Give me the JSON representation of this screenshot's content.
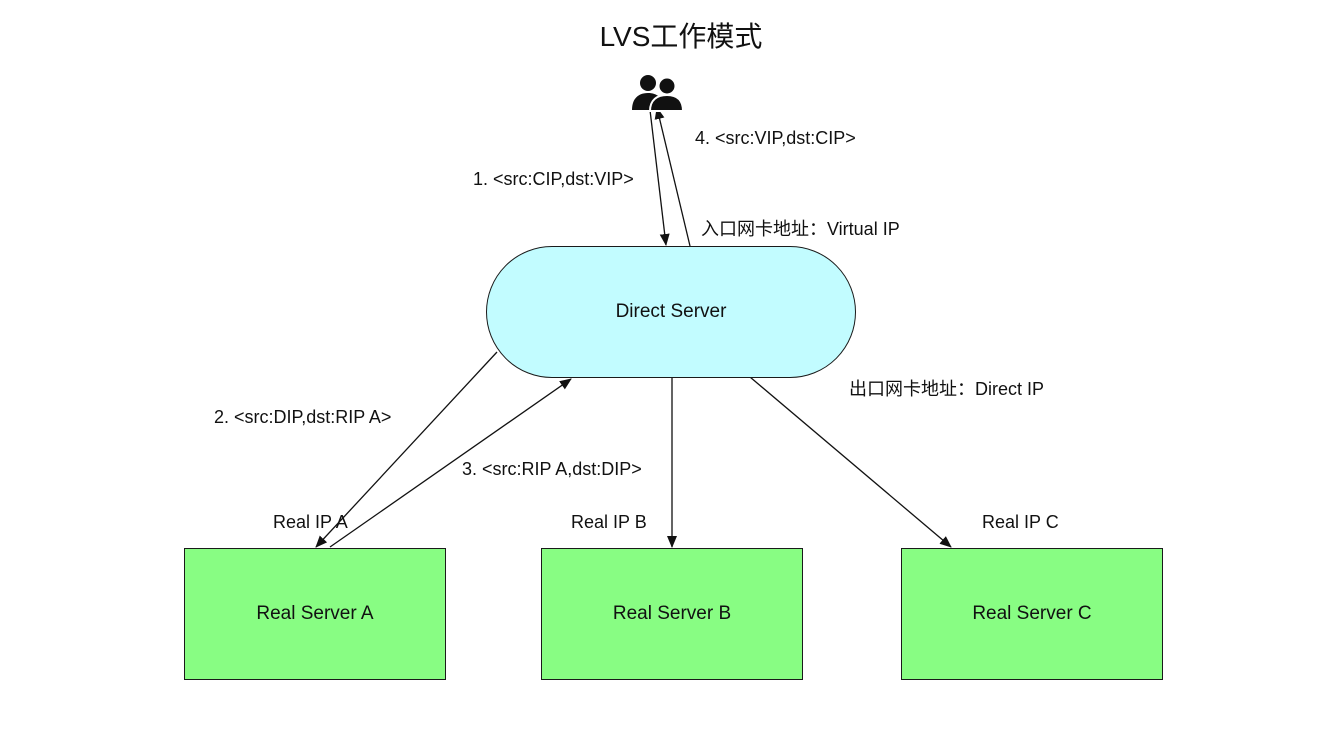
{
  "title": "LVS工作模式",
  "client": {
    "icon": "users-icon"
  },
  "direct_server": {
    "label": "Direct Server"
  },
  "interface_labels": {
    "ingress": "入口网卡地址：Virtual IP",
    "egress": "出口网卡地址：Direct IP"
  },
  "steps": {
    "step1": "1. <src:CIP,dst:VIP>",
    "step2": "2. <src:DIP,dst:RIP A>",
    "step3": "3. <src:RIP A,dst:DIP>",
    "step4": "4. <src:VIP,dst:CIP>"
  },
  "real_servers": [
    {
      "ip_label": "Real IP A",
      "label": "Real Server A"
    },
    {
      "ip_label": "Real IP B",
      "label": "Real Server B"
    },
    {
      "ip_label": "Real IP C",
      "label": "Real Server C"
    }
  ],
  "colors": {
    "direct_server_fill": "#c2fcff",
    "real_server_fill": "#88fd83",
    "edge": "#111111"
  }
}
